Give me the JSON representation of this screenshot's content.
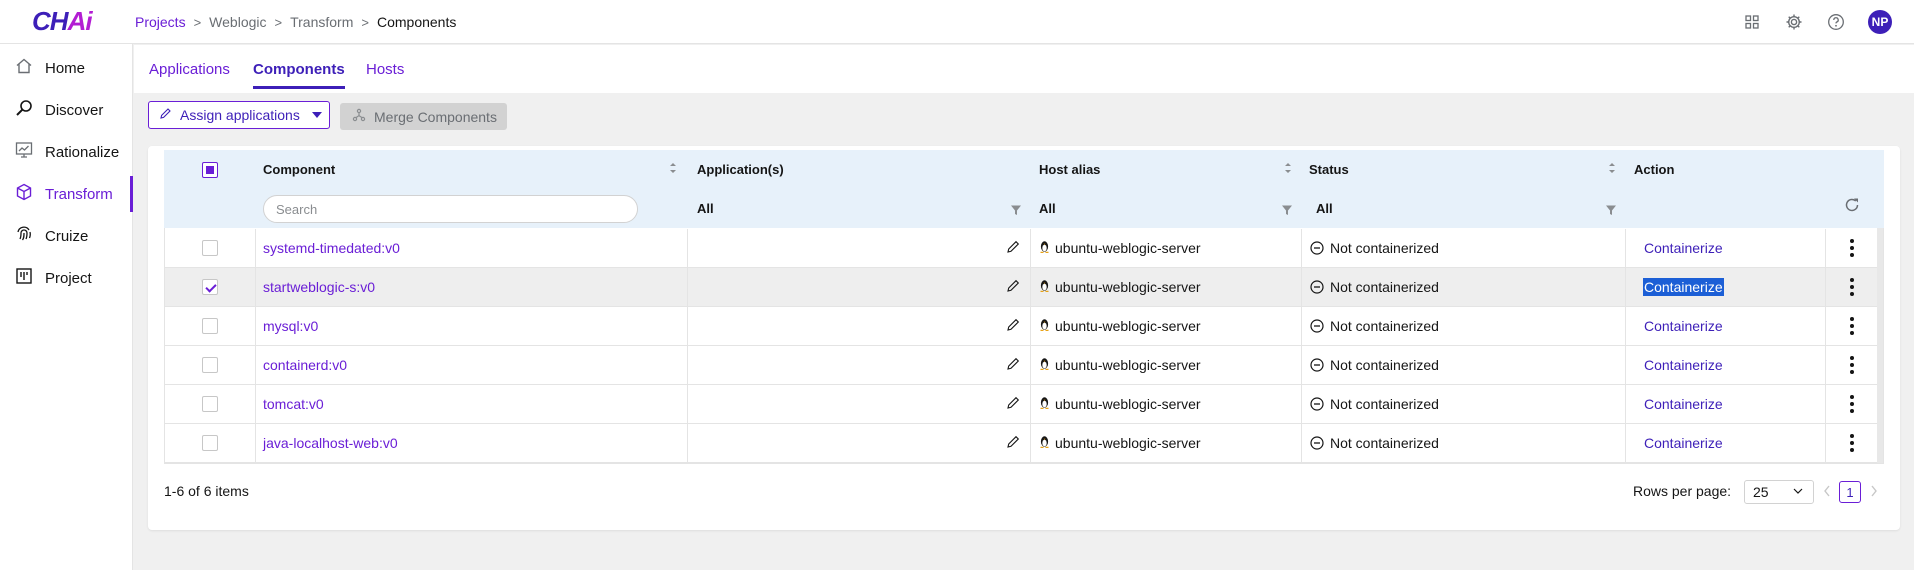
{
  "app": {
    "logo": "CHAi",
    "logo_main": "CH",
    "logo_accent": "Ai",
    "avatar_initials": "NP"
  },
  "breadcrumb": [
    {
      "label": "Projects",
      "kind": "link"
    },
    {
      "label": "Weblogic",
      "kind": "mid"
    },
    {
      "label": "Transform",
      "kind": "mid"
    },
    {
      "label": "Components",
      "kind": "current"
    }
  ],
  "sidebar": {
    "items": [
      {
        "label": "Home",
        "icon": "home-icon"
      },
      {
        "label": "Discover",
        "icon": "magnify-icon"
      },
      {
        "label": "Rationalize",
        "icon": "chart-board-icon"
      },
      {
        "label": "Transform",
        "icon": "cube-icon",
        "active": true
      },
      {
        "label": "Cruize",
        "icon": "fingerprint-icon"
      },
      {
        "label": "Project",
        "icon": "kanban-icon"
      }
    ]
  },
  "tabs": [
    {
      "label": "Applications"
    },
    {
      "label": "Components",
      "active": true
    },
    {
      "label": "Hosts"
    }
  ],
  "toolbar": {
    "assign_label": "Assign applications",
    "merge_label": "Merge Components"
  },
  "table": {
    "columns": {
      "component": "Component",
      "applications": "Application(s)",
      "host_alias": "Host alias",
      "status": "Status",
      "action": "Action"
    },
    "filters": {
      "search_placeholder": "Search",
      "applications": "All",
      "host_alias": "All",
      "status": "All"
    },
    "rows": [
      {
        "component": "systemd-timedated:v0",
        "host": "ubuntu-weblogic-server",
        "status": "Not containerized",
        "action": "Containerize",
        "checked": false
      },
      {
        "component": "startweblogic-s:v0",
        "host": "ubuntu-weblogic-server",
        "status": "Not containerized",
        "action": "Containerize",
        "checked": true
      },
      {
        "component": "mysql:v0",
        "host": "ubuntu-weblogic-server",
        "status": "Not containerized",
        "action": "Containerize",
        "checked": false
      },
      {
        "component": "containerd:v0",
        "host": "ubuntu-weblogic-server",
        "status": "Not containerized",
        "action": "Containerize",
        "checked": false
      },
      {
        "component": "tomcat:v0",
        "host": "ubuntu-weblogic-server",
        "status": "Not containerized",
        "action": "Containerize",
        "checked": false
      },
      {
        "component": "java-localhost-web:v0",
        "host": "ubuntu-weblogic-server",
        "status": "Not containerized",
        "action": "Containerize",
        "checked": false
      }
    ]
  },
  "pagination": {
    "summary": "1-6 of 6 items",
    "rows_per_page_label": "Rows per page:",
    "rows_per_page": "25",
    "current_page": "1"
  },
  "colors": {
    "primary": "#6a1ed6",
    "primary_dark": "#3d1fb8",
    "header_bg": "#e7f1fa",
    "highlight": "#1c5fd6"
  }
}
